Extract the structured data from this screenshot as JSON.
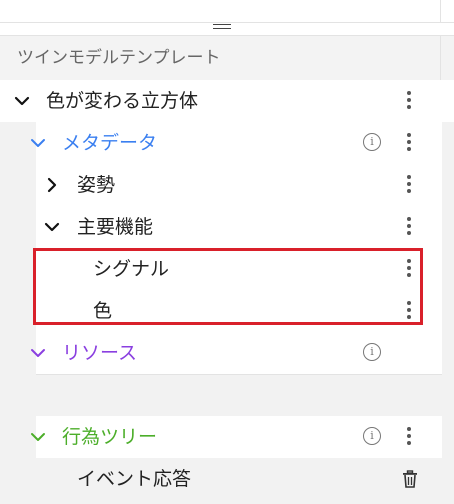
{
  "panel": {
    "header_title": "ツインモデルテンプレート"
  },
  "tree": {
    "root": {
      "label": "色が変わる立方体"
    },
    "metadata": {
      "label": "メタデータ",
      "color": "#3a7ff0"
    },
    "pose": {
      "label": "姿勢"
    },
    "main_function": {
      "label": "主要機能"
    },
    "signal": {
      "label": "シグナル"
    },
    "color": {
      "label": "色"
    },
    "resources": {
      "label": "リソース",
      "color": "#8a3fe0"
    },
    "behavior_tree": {
      "label": "行為ツリー",
      "color": "#4cae2a"
    },
    "event_response": {
      "label": "イベント応答"
    }
  },
  "highlight": {
    "color": "#d9202a"
  },
  "icons": {
    "expand": "chevron-down-icon",
    "collapse": "chevron-right-icon",
    "more": "kebab-icon",
    "info": "info-icon",
    "delete": "trash-icon",
    "drag": "drag-handle-icon"
  }
}
